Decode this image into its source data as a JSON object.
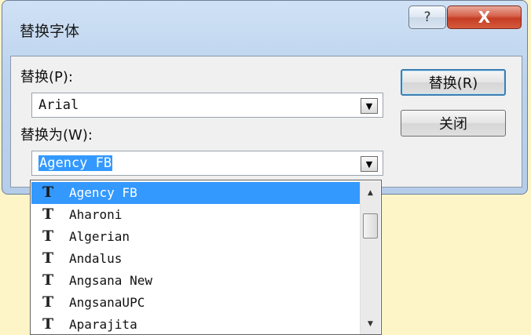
{
  "dialog": {
    "title": "替换字体",
    "help_label": "?",
    "close_label": "X"
  },
  "replace": {
    "label": "替换(P):",
    "value": "Arial"
  },
  "replace_with": {
    "label": "替换为(W):",
    "value": "Agency FB"
  },
  "buttons": {
    "replace": "替换(R)",
    "close": "关闭"
  },
  "font_list": {
    "items": [
      {
        "icon": "truetype-font-icon",
        "glyph": "T",
        "name": "Agency FB",
        "selected": true
      },
      {
        "icon": "truetype-font-icon",
        "glyph": "T",
        "name": "Aharoni",
        "selected": false
      },
      {
        "icon": "truetype-font-icon",
        "glyph": "T",
        "name": "Algerian",
        "selected": false
      },
      {
        "icon": "truetype-font-icon",
        "glyph": "T",
        "name": "Andalus",
        "selected": false
      },
      {
        "icon": "truetype-font-icon",
        "glyph": "T",
        "name": "Angsana New",
        "selected": false
      },
      {
        "icon": "truetype-font-icon",
        "glyph": "T",
        "name": "AngsanaUPC",
        "selected": false
      },
      {
        "icon": "truetype-font-icon",
        "glyph": "T",
        "name": "Aparajita",
        "selected": false
      }
    ]
  },
  "colors": {
    "selection": "#3399ff",
    "close_button": "#c43d24"
  }
}
